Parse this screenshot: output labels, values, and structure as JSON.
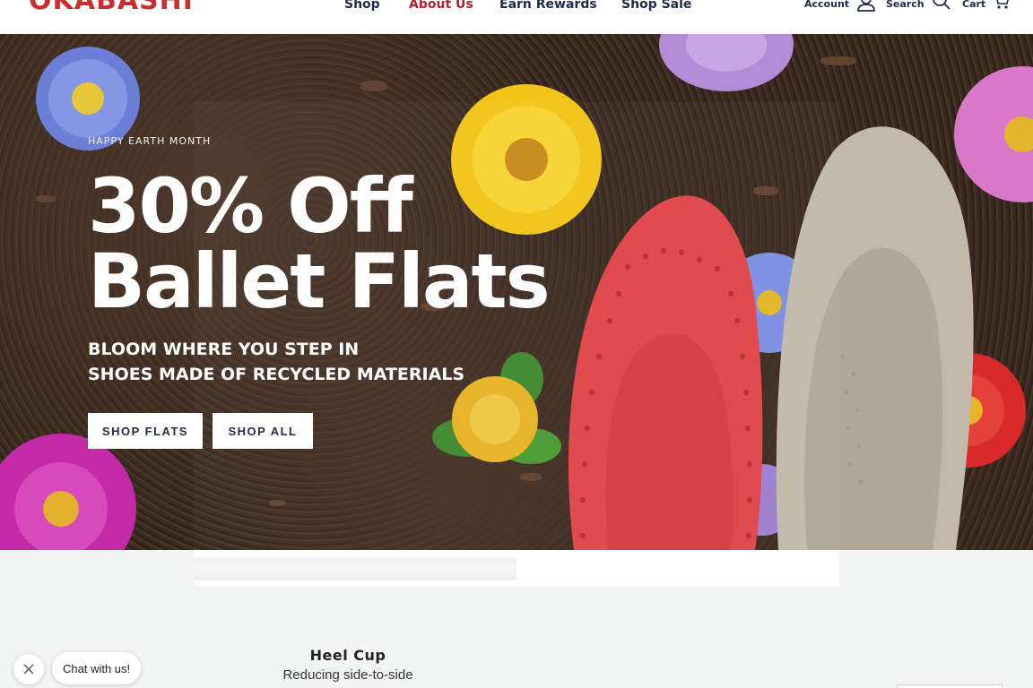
{
  "header": {
    "logo_text": "OKABASHI",
    "nav": [
      {
        "label": "Shop"
      },
      {
        "label": "About Us"
      },
      {
        "label": "Earn Rewards"
      },
      {
        "label": "Shop Sale"
      }
    ],
    "account_label": "Account",
    "search_label": "Search",
    "cart_label": "Cart"
  },
  "hero": {
    "eyebrow": "HAPPY EARTH MONTH",
    "title_line1": "30% Off",
    "title_line2": "Ballet Flats",
    "sub_line1": "BLOOM WHERE YOU STEP IN",
    "sub_line2": "SHOES MADE OF RECYCLED MATERIALS",
    "button_shop_flats": "SHOP FLATS",
    "button_shop_all": "SHOP ALL"
  },
  "feature": {
    "title": "Heel Cup",
    "text": "Reducing side-to-side"
  },
  "chat": {
    "label": "Chat with us!"
  },
  "colors": {
    "brand_red": "#c8302f",
    "nav_navy": "#1f2b4a",
    "shoe_red": "#e0464a",
    "shoe_beige": "#bdb4a6"
  }
}
